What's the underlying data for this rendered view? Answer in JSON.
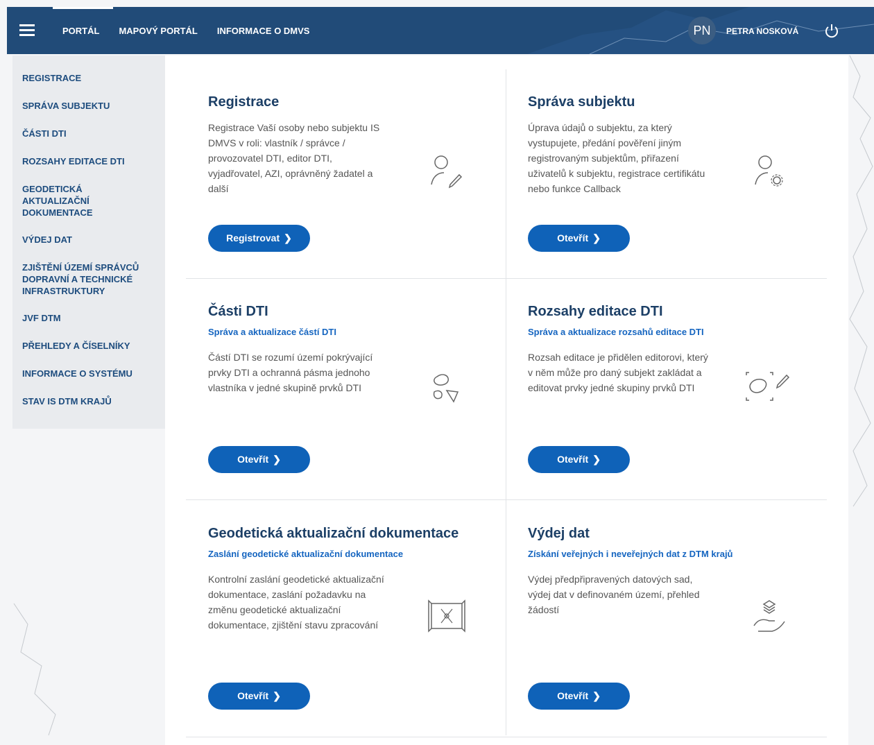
{
  "header": {
    "nav": [
      "PORTÁL",
      "MAPOVÝ PORTÁL",
      "INFORMACE O DMVS"
    ],
    "avatar_initials": "PN",
    "user_name": "PETRA NOSKOVÁ"
  },
  "sidebar": {
    "items": [
      "REGISTRACE",
      "SPRÁVA SUBJEKTU",
      "ČÁSTI DTI",
      "ROZSAHY EDITACE DTI",
      "GEODETICKÁ AKTUALIZAČNÍ DOKUMENTACE",
      "VÝDEJ DAT",
      "ZJIŠTĚNÍ ÚZEMÍ SPRÁVCŮ DOPRAVNÍ A TECHNICKÉ INFRASTRUKTURY",
      "JVF DTM",
      "PŘEHLEDY A ČÍSELNÍKY",
      "INFORMACE O SYSTÉMU",
      "STAV IS DTM KRAJŮ"
    ]
  },
  "cards": [
    {
      "title": "Registrace",
      "subtitle": "",
      "description": "Registrace Vaší osoby nebo subjektu IS DMVS v roli: vlastník / správce / provozovatel DTI, editor DTI, vyjadřovatel, AZI, oprávněný žadatel a další",
      "button": "Registrovat"
    },
    {
      "title": "Správa subjektu",
      "subtitle": "",
      "description": "Úprava údajů o subjektu, za který vystupujete, předání pověření jiným registrovaným subjektům, přiřazení uživatelů k subjektu, registrace certifikátu nebo funkce Callback",
      "button": "Otevřít"
    },
    {
      "title": "Části DTI",
      "subtitle": "Správa a aktualizace částí DTI",
      "description": "Částí DTI se rozumí území pokrývající prvky DTI a ochranná pásma jednoho vlastníka v jedné skupině prvků DTI",
      "button": "Otevřít"
    },
    {
      "title": "Rozsahy editace DTI",
      "subtitle": "Správa a aktualizace rozsahů editace DTI",
      "description": "Rozsah editace je přidělen editorovi, který v něm může pro daný subjekt zakládat a editovat prvky jedné skupiny prvků DTI",
      "button": "Otevřít"
    },
    {
      "title": "Geodetická aktualizační dokumentace",
      "subtitle": "Zaslání geodetické aktualizační dokumentace",
      "description": "Kontrolní zaslání geodetické aktualizační dokumentace, zaslání požadavku na změnu geodetické aktualizační dokumentace, zjištění stavu zpracování",
      "button": "Otevřít"
    },
    {
      "title": "Výdej dat",
      "subtitle": "Získání veřejných i neveřejných dat z DTM krajů",
      "description": "Výdej předpřipravených datových sad, výdej dat v definovaném území, přehled žádostí",
      "button": "Otevřít"
    }
  ]
}
